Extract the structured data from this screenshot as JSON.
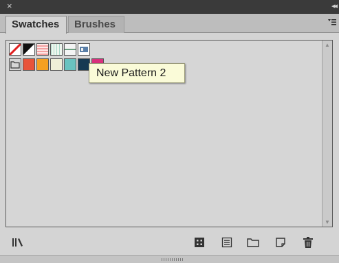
{
  "panel": {
    "tabs": [
      {
        "label": "Swatches",
        "active": true
      },
      {
        "label": "Brushes",
        "active": false
      }
    ]
  },
  "tooltip": {
    "text": "New Pattern 2"
  },
  "swatches": {
    "row1": [
      {
        "name": "none-swatch"
      },
      {
        "name": "registration-swatch"
      },
      {
        "name": "pattern-swatch-1"
      },
      {
        "name": "pattern-swatch-2"
      },
      {
        "name": "pattern-swatch-3"
      },
      {
        "name": "pattern-swatch-4"
      }
    ],
    "row2": [
      {
        "name": "color-group-folder"
      },
      {
        "name": "swatch-red",
        "color": "#e8543a"
      },
      {
        "name": "swatch-orange",
        "color": "#f5a021"
      },
      {
        "name": "swatch-cream",
        "color": "#efefd8"
      },
      {
        "name": "swatch-teal",
        "color": "#69c3c0"
      },
      {
        "name": "swatch-navy",
        "color": "#163a52"
      },
      {
        "name": "swatch-pink",
        "color": "#d9317d"
      }
    ]
  },
  "footer": {
    "icons": [
      "swatch-libraries-icon",
      "show-kinds-icon",
      "swatch-options-icon",
      "new-color-group-icon",
      "new-swatch-icon",
      "delete-swatch-icon"
    ]
  },
  "colors": {
    "panel_bg": "#d4d4d4",
    "tooltip_bg": "#fafbd8",
    "frame_bg": "#2a2a2a"
  }
}
